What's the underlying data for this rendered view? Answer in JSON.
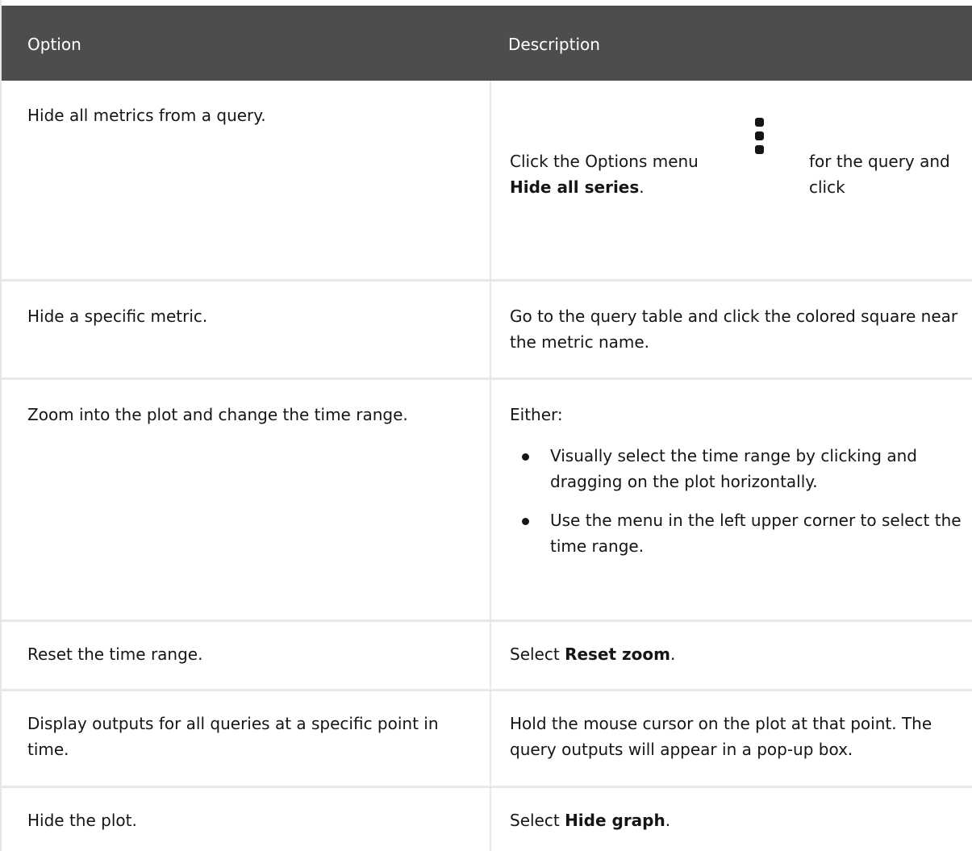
{
  "header": {
    "option": "Option",
    "description": "Description"
  },
  "rows": [
    {
      "option": "Hide all metrics from a query.",
      "desc_pre": "Click the Options menu ",
      "desc_icon": "kebab-icon",
      "desc_post": " for the query and click ",
      "desc_bold": "Hide all series",
      "desc_end": "."
    },
    {
      "option": "Hide a specific metric.",
      "desc": "Go to the query table and click the colored square near the metric name."
    },
    {
      "option": "Zoom into the plot and change the time range.",
      "desc_intro": "Either:",
      "bullets": [
        "Visually select the time range by clicking and dragging on the plot horizontally.",
        "Use the menu in the left upper corner to select the time range."
      ]
    },
    {
      "option": "Reset the time range.",
      "desc_pre": "Select ",
      "desc_bold": "Reset zoom",
      "desc_end": "."
    },
    {
      "option": "Display outputs for all queries at a specific point in time.",
      "desc": "Hold the mouse cursor on the plot at that point. The query outputs will appear in a pop-up box."
    },
    {
      "option": "Hide the plot.",
      "desc_pre": "Select ",
      "desc_bold": "Hide graph",
      "desc_end": "."
    }
  ]
}
